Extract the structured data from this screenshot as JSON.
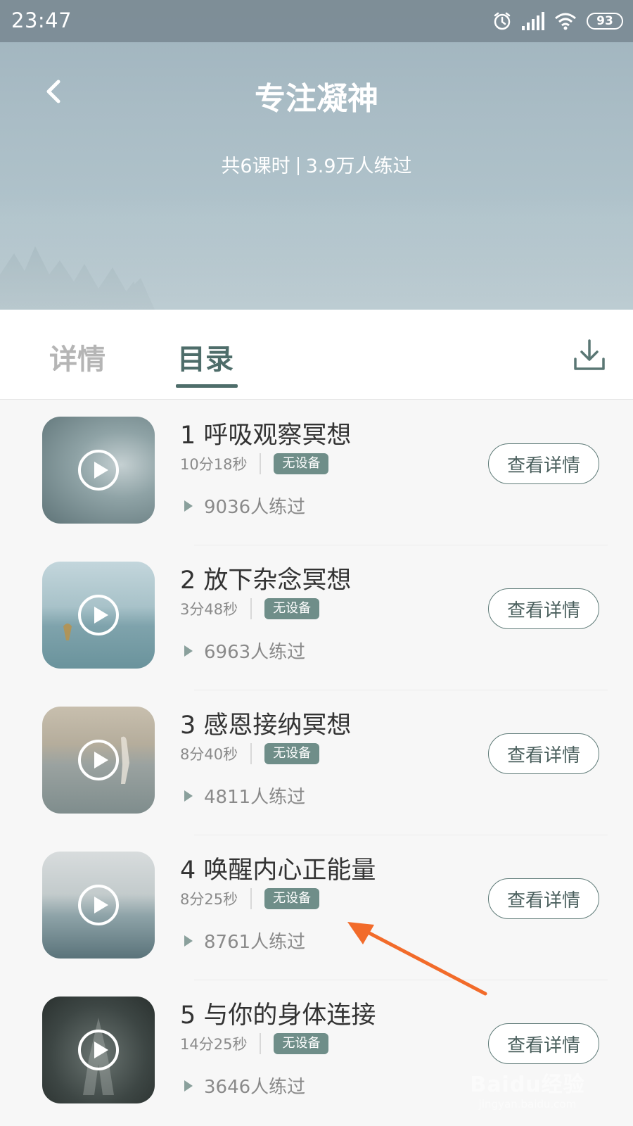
{
  "status_bar": {
    "time": "23:47",
    "battery": "93",
    "icons": [
      "alarm-icon",
      "signal-icon",
      "wifi-icon",
      "battery-icon"
    ]
  },
  "header": {
    "title": "专注凝神",
    "lessons": "共6课时",
    "practiced": "3.9万人练过"
  },
  "tabs": [
    {
      "label": "详情",
      "active": false
    },
    {
      "label": "目录",
      "active": true
    }
  ],
  "colors": {
    "accent": "#4e6d6a",
    "badge": "#6f8e89",
    "annotation_arrow": "#f26b2a"
  },
  "lessons": [
    {
      "title": "1 呼吸观察冥想",
      "duration": "10分18秒",
      "badge": "无设备",
      "count": "9036人练过",
      "button": "查看详情"
    },
    {
      "title": "2 放下杂念冥想",
      "duration": "3分48秒",
      "badge": "无设备",
      "count": "6963人练过",
      "button": "查看详情"
    },
    {
      "title": "3 感恩接纳冥想",
      "duration": "8分40秒",
      "badge": "无设备",
      "count": "4811人练过",
      "button": "查看详情"
    },
    {
      "title": "4 唤醒内心正能量",
      "duration": "8分25秒",
      "badge": "无设备",
      "count": "8761人练过",
      "button": "查看详情"
    },
    {
      "title": "5 与你的身体连接",
      "duration": "14分25秒",
      "badge": "无设备",
      "count": "3646人练过",
      "button": "查看详情"
    }
  ],
  "watermark": {
    "logo": "Baidu经验",
    "url": "jingyan.baidu.com"
  }
}
